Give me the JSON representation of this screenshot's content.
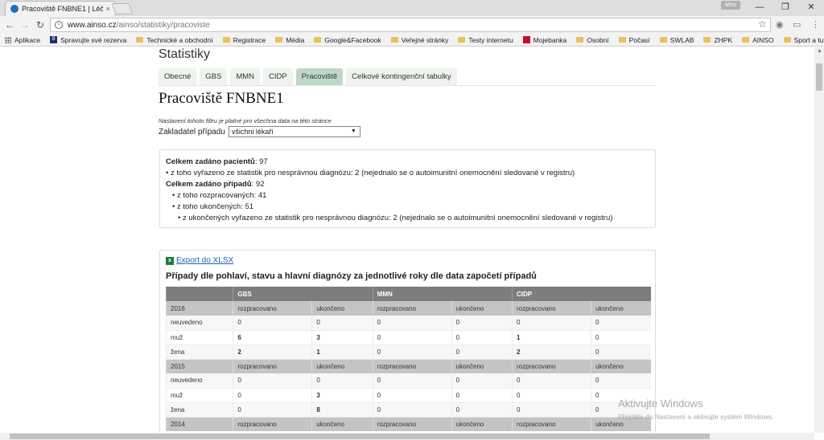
{
  "browser": {
    "tab_title": "Pracoviště FNBNE1 | Léč",
    "tab_close": "×",
    "profile": "Miro",
    "url_host": "www.ainso.cz",
    "url_path": "/ainso/statistiky/pracoviste",
    "window_controls": [
      "—",
      "❐",
      "✕"
    ],
    "nav": {
      "back": "←",
      "forward": "→",
      "reload": "↻"
    },
    "bookmarks": [
      {
        "label": "Aplikace",
        "icon": "apps-icon"
      },
      {
        "label": "Spravujte své rezerva",
        "icon": "blue-icon"
      },
      {
        "label": "Technické a obchodní",
        "icon": "folder-icon"
      },
      {
        "label": "Registrace",
        "icon": "folder-icon"
      },
      {
        "label": "Média",
        "icon": "folder-icon"
      },
      {
        "label": "Google&Facebook",
        "icon": "folder-icon"
      },
      {
        "label": "Veřejné stránky",
        "icon": "folder-icon"
      },
      {
        "label": "Testy internetu",
        "icon": "folder-icon"
      },
      {
        "label": "Mojebanka",
        "icon": "red-icon"
      },
      {
        "label": "Osobní",
        "icon": "folder-icon"
      },
      {
        "label": "Počasí",
        "icon": "folder-icon"
      },
      {
        "label": "SWLAB",
        "icon": "folder-icon"
      },
      {
        "label": "ZHPK",
        "icon": "folder-icon"
      },
      {
        "label": "AINSO",
        "icon": "folder-icon"
      },
      {
        "label": "Sport a turistika",
        "icon": "folder-icon"
      }
    ]
  },
  "page": {
    "section_title": "Statistiky",
    "tabs": [
      {
        "label": "Obecné",
        "active": false
      },
      {
        "label": "GBS",
        "active": false
      },
      {
        "label": "MMN",
        "active": false
      },
      {
        "label": "CIDP",
        "active": false
      },
      {
        "label": "Pracoviště",
        "active": true
      },
      {
        "label": "Celkové kontingenční tabulky",
        "active": false
      }
    ],
    "title": "Pracoviště FNBNE1",
    "filter_note": "Nastavení tohoto filtru je platné pro všechna data na této stránce",
    "filter_label": "Zakladatel případu",
    "filter_value": "všichni lékaři",
    "summary": {
      "patients_label": "Celkem zadáno pacientů",
      "patients_value": ": 97",
      "patients_excluded": "• z toho vyřazeno ze statistik pro nesprávnou diagnózu: 2 (nejednalo se o autoimunitní onemocnění sledované v registru)",
      "cases_label": "Celkem zadáno případů",
      "cases_value": ": 92",
      "cases_in_progress": "• z toho rozpracovaných: 41",
      "cases_finished": "• z toho ukončených: 51",
      "cases_finished_excluded": "• z ukončených vyřazeno ze statistik pro nesprávnou diagnózu: 2 (nejednalo se o autoimunitní onemocnění sledované v registru)"
    },
    "export_label": "Export do XLSX",
    "table_title": "Případy dle pohlaví, stavu a hlavní diagnózy za jednotlivé roky dle data započetí případů",
    "table": {
      "groups": [
        "GBS",
        "MMN",
        "CIDP"
      ],
      "subheaders": [
        "rozpracovano",
        "ukončeno",
        "rozpracovano",
        "ukončeno",
        "rozpracovano",
        "ukončeno"
      ],
      "years": [
        {
          "year": "2016",
          "rows": [
            {
              "label": "neuvedeno",
              "values": [
                "0",
                "0",
                "0",
                "0",
                "0",
                "0"
              ]
            },
            {
              "label": "muž",
              "values": [
                "6",
                "3",
                "0",
                "0",
                "1",
                "0"
              ]
            },
            {
              "label": "žena",
              "values": [
                "2",
                "1",
                "0",
                "0",
                "2",
                "0"
              ]
            }
          ]
        },
        {
          "year": "2015",
          "rows": [
            {
              "label": "neuvedeno",
              "values": [
                "0",
                "0",
                "0",
                "0",
                "0",
                "0"
              ]
            },
            {
              "label": "muž",
              "values": [
                "0",
                "3",
                "0",
                "0",
                "0",
                "0"
              ]
            },
            {
              "label": "žena",
              "values": [
                "0",
                "8",
                "0",
                "0",
                "0",
                "0"
              ]
            }
          ]
        },
        {
          "year": "2014",
          "rows": []
        }
      ]
    }
  },
  "watermark": {
    "title": "Aktivujte Windows",
    "subtitle": "Přejděte do Nastavení a aktivujte systém Windows."
  }
}
